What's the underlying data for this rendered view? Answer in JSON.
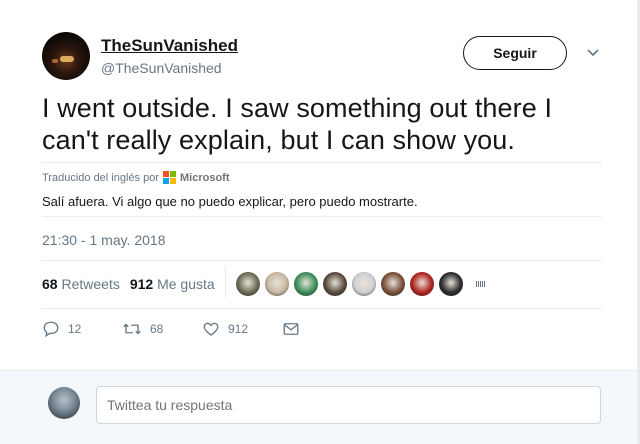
{
  "user": {
    "display_name": "TheSunVanished",
    "handle": "@TheSunVanished"
  },
  "follow_button_label": "Seguir",
  "tweet": {
    "text": "I went outside. I saw something out there I can't really explain, but I can show you.",
    "translated_by_label": "Traducido del inglés por",
    "translator_name": "Microsoft",
    "translation": "Salí afuera. Vi algo que no puedo explicar, pero puedo mostrarte.",
    "timestamp": "21:30 - 1 may. 2018"
  },
  "stats": {
    "retweets_count": "68",
    "retweets_label": "Retweets",
    "likes_count": "912",
    "likes_label": "Me gusta"
  },
  "likers": [
    {
      "color": "#6b6a55"
    },
    {
      "color": "#c9b8a3"
    },
    {
      "color": "#3b8f5a"
    },
    {
      "color": "#5a4a3c"
    },
    {
      "color": "#cfcfd4"
    },
    {
      "color": "#7a4e3a"
    },
    {
      "color": "#b0231e"
    },
    {
      "color": "#2b2b2b"
    }
  ],
  "actions": {
    "reply_count": "12",
    "retweet_count": "68",
    "like_count": "912"
  },
  "reply_box": {
    "placeholder": "Twittea tu respuesta"
  },
  "colors": {
    "text_primary": "#14171a",
    "text_secondary": "#657786",
    "divider": "#e6ecf0",
    "reply_bg": "#f5f8fa"
  },
  "icons": {
    "reply": "reply-icon",
    "retweet": "retweet-icon",
    "like": "heart-icon",
    "dm": "envelope-icon",
    "caret": "chevron-down-icon",
    "translator_logo": "microsoft-logo-icon"
  }
}
